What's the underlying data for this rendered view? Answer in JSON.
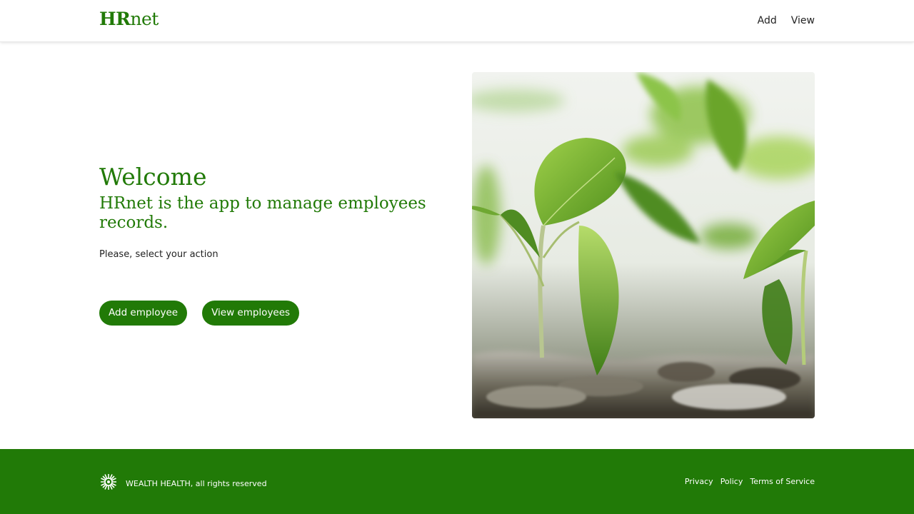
{
  "header": {
    "logo_strong": "HR",
    "logo_rest": "net",
    "nav": [
      {
        "label": "Add"
      },
      {
        "label": "View"
      }
    ]
  },
  "hero": {
    "title": "Welcome",
    "tagline": "HRnet is the app to manage employees records.",
    "prompt": "Please, select your action",
    "buttons": [
      {
        "label": "Add employee"
      },
      {
        "label": "View employees"
      }
    ]
  },
  "footer": {
    "brand_text": "WEALTH HEALTH, all rights reserved",
    "links": [
      {
        "label": "Privacy"
      },
      {
        "label": "Policy"
      },
      {
        "label": "Terms of Service"
      }
    ]
  },
  "colors": {
    "brand": "#217a07",
    "text": "#222222",
    "background": "#ffffff"
  },
  "icons": {
    "footer_logo": "wealth-health-logo"
  }
}
